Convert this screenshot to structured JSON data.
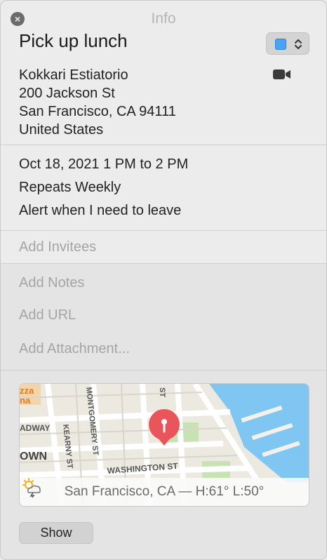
{
  "window": {
    "title": "Info"
  },
  "event": {
    "title": "Pick up lunch",
    "calendar_color": "#4aa3f5",
    "location_lines": [
      "Kokkari Estiatorio",
      "200 Jackson St",
      "San Francisco, CA  94111",
      "United States"
    ],
    "datetime": "Oct 18, 2021  1 PM to 2 PM",
    "repeat": "Repeats Weekly",
    "alert": "Alert when I need to leave"
  },
  "placeholders": {
    "invitees": "Add Invitees",
    "notes": "Add Notes",
    "url": "Add URL",
    "attachment": "Add Attachment..."
  },
  "map": {
    "street_labels": [
      "MONTGOMERY ST",
      "KEARNY ST",
      "WASHINGTON ST",
      "ADWAY",
      "OWN",
      "ST",
      "zza",
      "na"
    ],
    "weather": {
      "location": "San Francisco, CA —",
      "icon": "partly-cloudy-thunder-icon",
      "temps": "H:61° L:50°"
    }
  },
  "buttons": {
    "show": "Show"
  }
}
